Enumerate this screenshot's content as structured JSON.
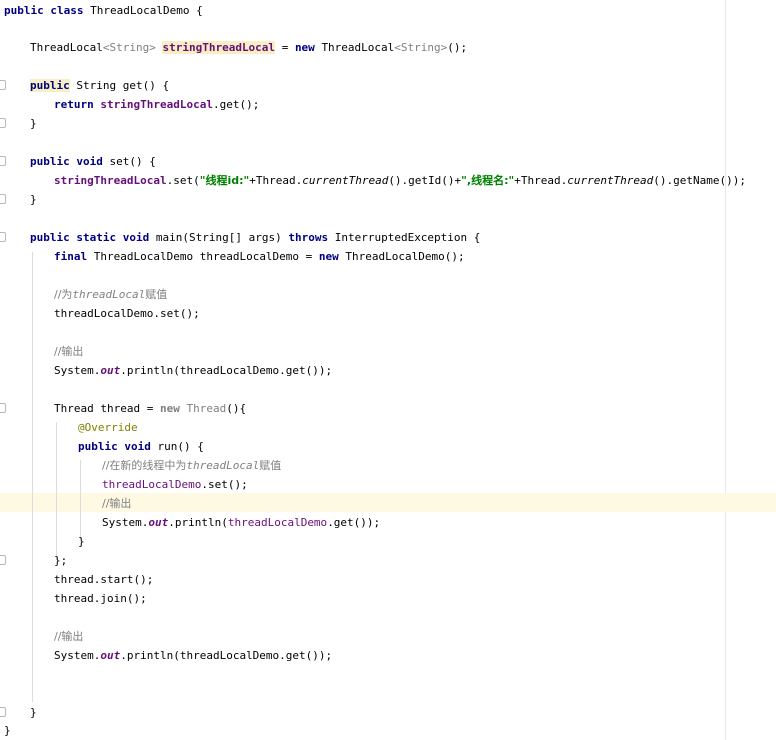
{
  "colors": {
    "keyword": "#000080",
    "field": "#660e7a",
    "string": "#008000",
    "comment": "#808080",
    "annotation": "#808000",
    "caret_row": "#fdf9e3",
    "field_highlight": "#f7eec3"
  },
  "code": {
    "l1_kw1": "public",
    "l1_kw2": "class",
    "l1_name": "ThreadLocalDemo",
    "l1_brace": "{",
    "l3_type": "ThreadLocal",
    "l3_gen1": "<String>",
    "l3_field": "stringThreadLocal",
    "l3_eq": "=",
    "l3_new": "new",
    "l3_ctor": "ThreadLocal",
    "l3_gen2": "<String>",
    "l3_tail": "();",
    "l5_kw": "public",
    "l5_rest": "String get() {",
    "l6_kw": "return",
    "l6_field": "stringThreadLocal",
    "l6_tail": ".get();",
    "l7": "}",
    "l9_kw1": "public",
    "l9_kw2": "void",
    "l9_rest": "set() {",
    "l10_field": "stringThreadLocal",
    "l10_a": ".set(",
    "l10_str1": "\"线程id:\"",
    "l10_b": "+Thread.",
    "l10_m1": "currentThread",
    "l10_c": "().getId()+",
    "l10_str2": "\",线程名:\"",
    "l10_d": "+Thread.",
    "l10_m2": "currentThread",
    "l10_e": "().getName());",
    "l11": "}",
    "l13_kw1": "public",
    "l13_kw2": "static",
    "l13_kw3": "void",
    "l13_a": "main(String[] args)",
    "l13_kw4": "throws",
    "l13_b": "InterruptedException {",
    "l14_kw1": "final",
    "l14_a": "ThreadLocalDemo threadLocalDemo =",
    "l14_kw2": "new",
    "l14_b": "ThreadLocalDemo();",
    "l16_c1": "//为",
    "l16_c2": "threadLocal",
    "l16_c3": "赋值",
    "l17": "threadLocalDemo.set();",
    "l19": "//输出",
    "l20_a": "System.",
    "l20_out": "out",
    "l20_b": ".println(threadLocalDemo.get());",
    "l22_a": "Thread thread =",
    "l22_new": "new",
    "l22_b": "Thread",
    "l22_c": "(){",
    "l23": "@Override",
    "l24_kw1": "public",
    "l24_kw2": "void",
    "l24_rest": "run() {",
    "l25_c1": "//在新的线程中为",
    "l25_c2": "threadLocal",
    "l25_c3": "赋值",
    "l26_var": "threadLocalDemo",
    "l26_tail": ".set();",
    "l27": "//输出",
    "l28_a": "System.",
    "l28_out": "out",
    "l28_b": ".println(",
    "l28_var": "threadLocalDemo",
    "l28_c": ".get());",
    "l29": "}",
    "l30": "};",
    "l31": "thread.start();",
    "l32": "thread.join();",
    "l34": "//输出",
    "l35_a": "System.",
    "l35_out": "out",
    "l35_b": ".println(threadLocalDemo.get());",
    "l38": "}",
    "l39": "}"
  }
}
